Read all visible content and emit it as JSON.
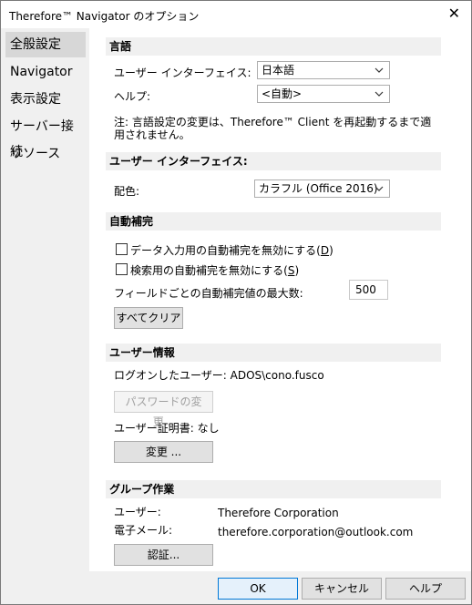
{
  "window": {
    "title": "Therefore™ Navigator のオプション",
    "close_glyph": "✕"
  },
  "sidebar": {
    "items": [
      {
        "label": "全般設定",
        "selected": true
      },
      {
        "label": "Navigator"
      },
      {
        "label": "表示設定"
      },
      {
        "label": "サーバー接続"
      },
      {
        "label": "リソース"
      }
    ]
  },
  "language": {
    "section_title": "言語",
    "ui_label": "ユーザー インターフェイス:",
    "ui_value": "日本語",
    "help_label": "ヘルプ:",
    "help_value": "<自動>",
    "note_line1": "注: 言語設定の変更は、Therefore™ Client を再起動するまで適",
    "note_line2": "用されません。"
  },
  "ui": {
    "section_title": "ユーザー インターフェイス:",
    "color_label": "配色:",
    "color_value": "カラフル (Office 2016)"
  },
  "autocomplete": {
    "section_title": "自動補完",
    "disable_data_entry": {
      "label": "データ入力用の自動補完を無効にする(",
      "key": "D",
      "suffix": ")",
      "checked": false
    },
    "disable_search": {
      "label": "検索用の自動補完を無効にする(",
      "key": "S",
      "suffix": ")",
      "checked": false
    },
    "max_label": "フィールドごとの自動補完値の最大数:",
    "max_value": "500",
    "clear_all": "すべてクリア"
  },
  "user_info": {
    "section_title": "ユーザー情報",
    "logged_on": "ログオンしたユーザー: ADOS\\cono.fusco",
    "change_password": "パスワードの変更...",
    "certificate": "ユーザー証明書: なし",
    "change": "変更 ..."
  },
  "groupware": {
    "section_title": "グループ作業",
    "user_label": "ユーザー:",
    "user_value": "Therefore Corporation",
    "email_label": "電子メール:",
    "email_value": "therefore.corporation@outlook.com",
    "auth": "認証..."
  },
  "footer": {
    "ok": "OK",
    "cancel": "キャンセル",
    "help": "ヘルプ"
  },
  "colors": {
    "sidebar_bg": "#f0f0f0",
    "selected_bg": "#d7d7d7",
    "section_bg": "#f0f0f0",
    "ok_border": "#0078d7"
  }
}
